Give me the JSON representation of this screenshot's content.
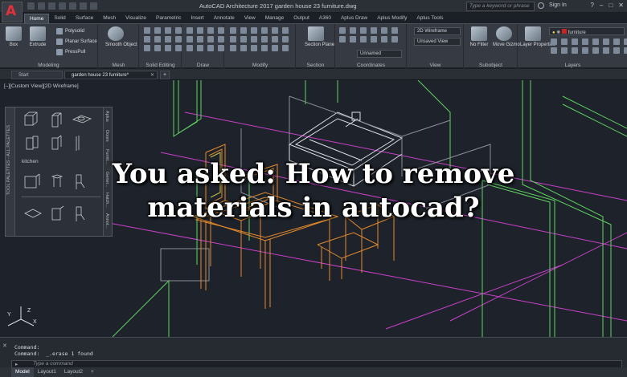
{
  "app": {
    "logo_letter": "A",
    "title": "AutoCAD Architecture 2017    garden house 23 furniture.dwg",
    "search_placeholder": "Type a keyword or phrase",
    "sign_in": "Sign In",
    "window_controls": [
      "?",
      "–",
      "□",
      "✕"
    ]
  },
  "ribbon_tabs": [
    "Home",
    "Solid",
    "Surface",
    "Mesh",
    "Visualize",
    "Parametric",
    "Insert",
    "Annotate",
    "View",
    "Manage",
    "Output",
    "A360",
    "Aplus Draw",
    "Aplus Modify",
    "Aplus Tools"
  ],
  "ribbon": {
    "modeling": {
      "label": "Modeling",
      "box": "Box",
      "extrude": "Extrude",
      "polysolid": "Polysolid",
      "planar_surface": "Planar Surface",
      "presspull": "PressPull"
    },
    "mesh": {
      "label": "Mesh",
      "smooth_object": "Smooth Object"
    },
    "solid_editing": {
      "label": "Solid Editing"
    },
    "draw": {
      "label": "Draw"
    },
    "modify": {
      "label": "Modify"
    },
    "section": {
      "label": "Section",
      "section_plane": "Section Plane"
    },
    "coordinates": {
      "label": "Coordinates",
      "ucs_value": "Unnamed"
    },
    "view": {
      "label": "View",
      "visual_style": "2D Wireframe",
      "saved_view": "Unsaved View"
    },
    "subobject": {
      "label": "Subobject",
      "no_filter": "No Filter",
      "move_gizmo": "Move Gizmo"
    },
    "layers": {
      "label": "Layers",
      "layer_properties": "Layer Properties",
      "current_layer": "furniture"
    }
  },
  "file_tabs": {
    "start": "Start",
    "drawing": "garden house 23 furniture*"
  },
  "viewport_label": "[–][Custom View][2D Wireframe]",
  "palette": {
    "section_label": "kitchen",
    "side_title": "TOOL PALETTES - ALL PALETTES",
    "tabs": [
      "Aplus",
      "Doors",
      "Furnit...",
      "Gener...",
      "Hatch...",
      "Annot..."
    ]
  },
  "headline": {
    "line1": "You asked: How to remove",
    "line2": "materials in autocad?"
  },
  "ucs": {
    "x": "X",
    "y": "Y",
    "z": "Z"
  },
  "command": {
    "line1": "Command:",
    "line2": "Command:  _.erase 1 found",
    "prompt": "Type a command"
  },
  "layout_tabs": [
    "Model",
    "Layout1",
    "Layout2"
  ],
  "colors": {
    "wire_green": "#5fd35f",
    "wire_orange": "#e48a2c",
    "wire_magenta": "#c940c9",
    "wire_white": "#d9dde3"
  }
}
